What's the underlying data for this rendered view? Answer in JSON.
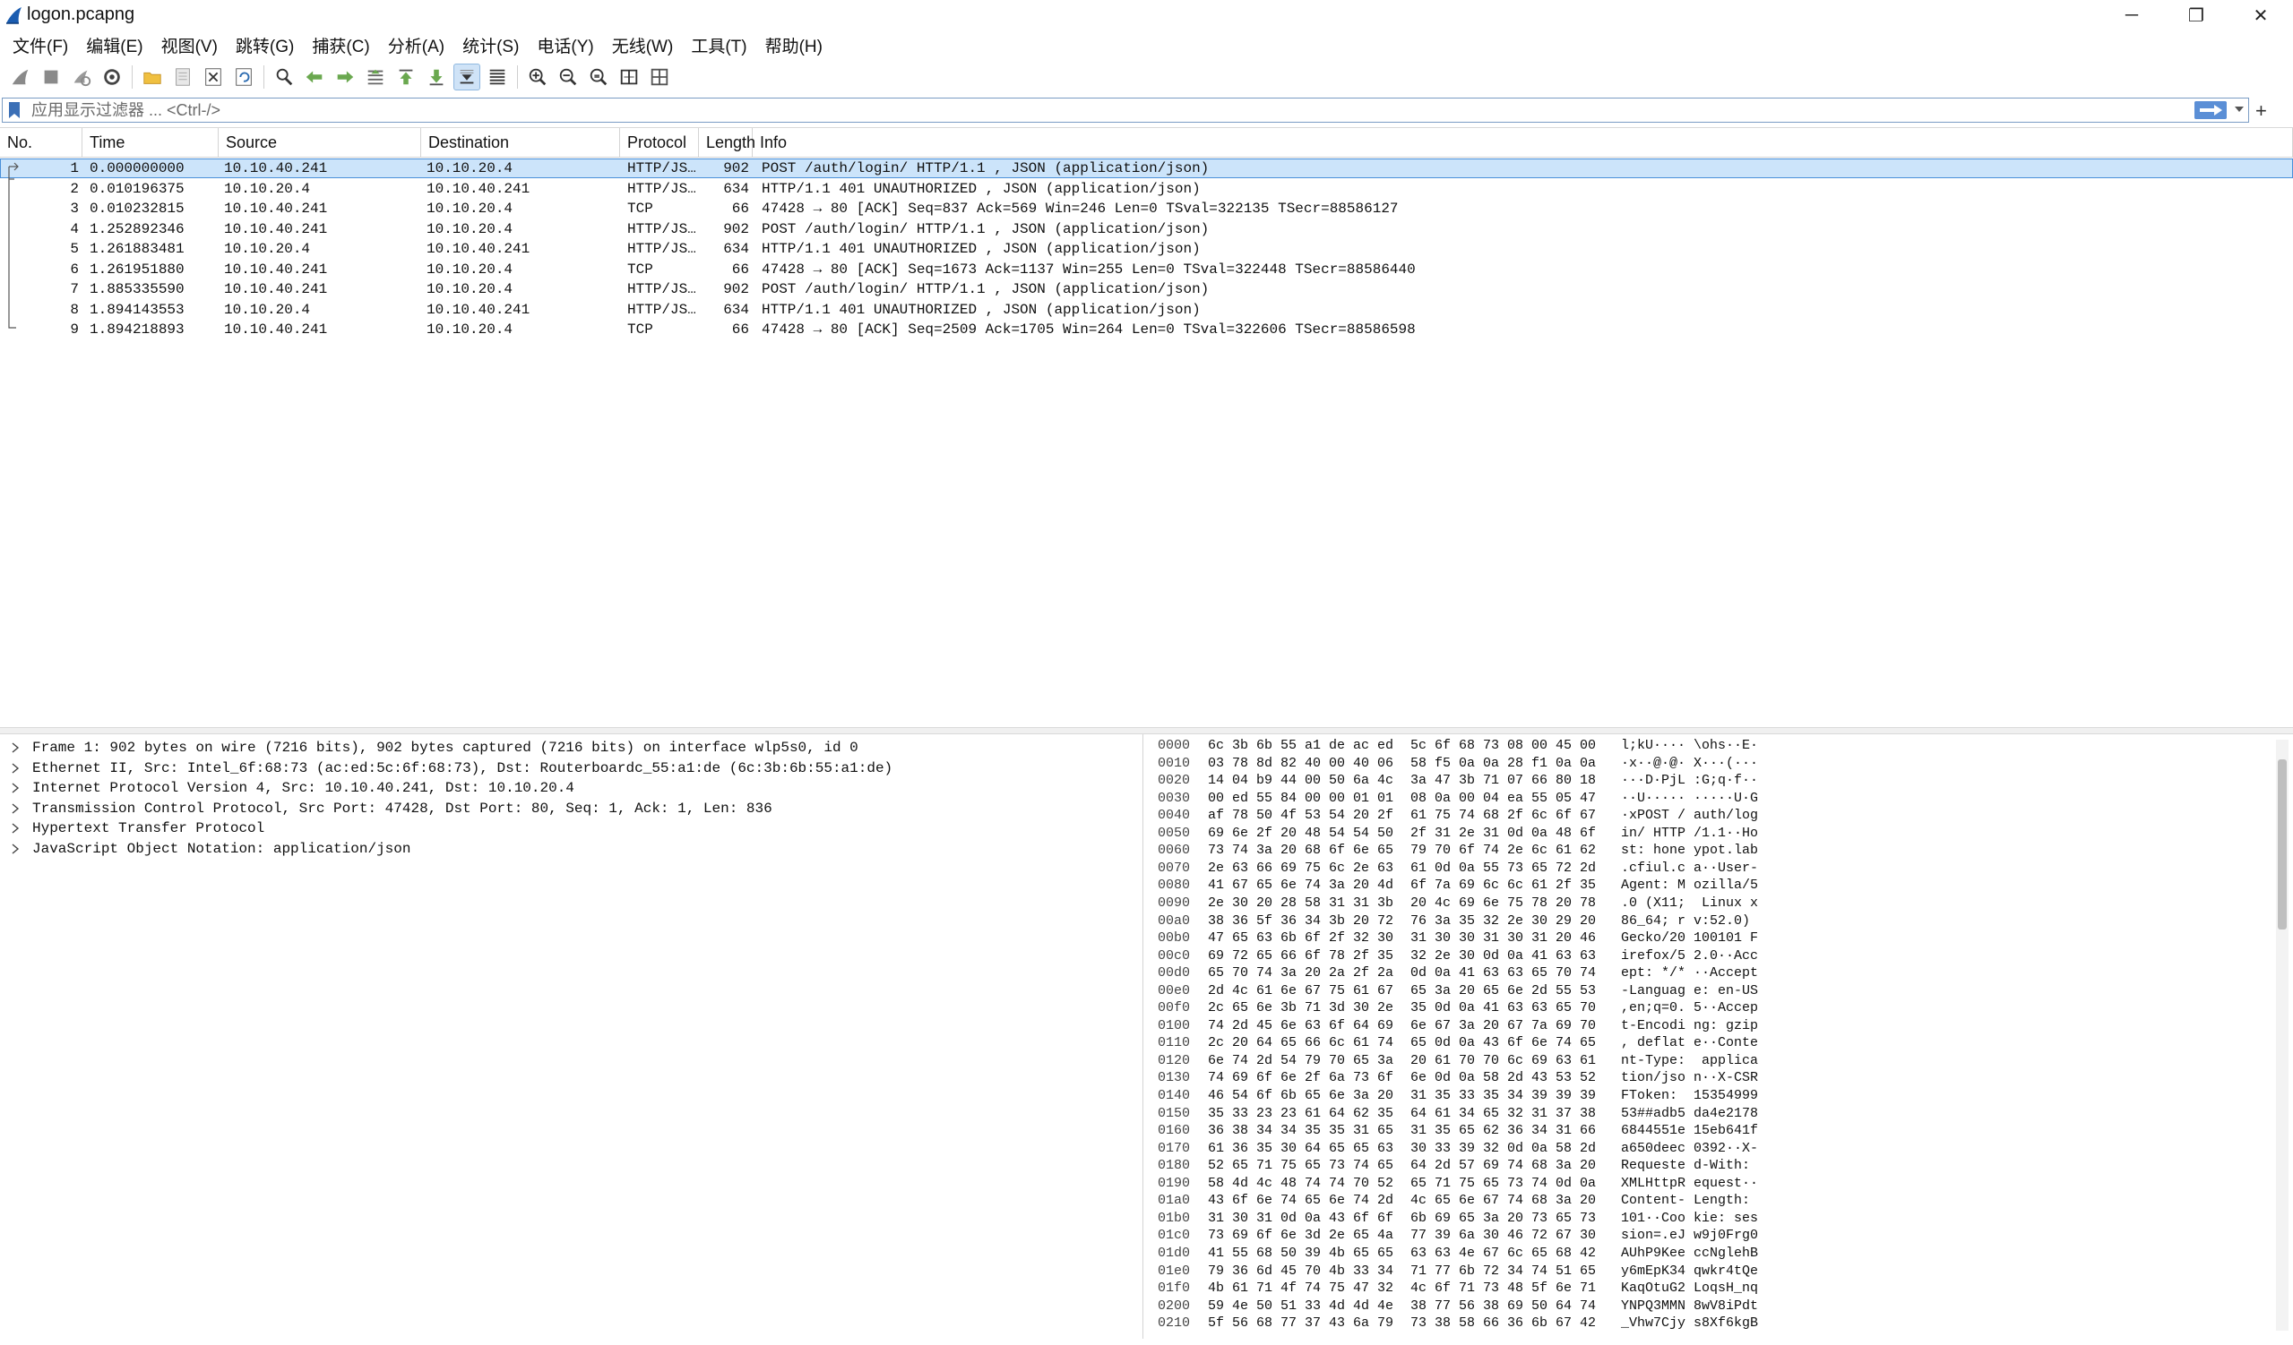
{
  "window": {
    "title": "logon.pcapng",
    "controls": {
      "minimize": "─",
      "maximize": "❐",
      "close": "✕"
    }
  },
  "menu": [
    "文件(F)",
    "编辑(E)",
    "视图(V)",
    "跳转(G)",
    "捕获(C)",
    "分析(A)",
    "统计(S)",
    "电话(Y)",
    "无线(W)",
    "工具(T)",
    "帮助(H)"
  ],
  "toolbar": {
    "icons": [
      "shark-fin-start-icon",
      "stop-capture-icon",
      "restart-capture-icon",
      "capture-options-icon",
      "open-folder-icon",
      "save-file-icon",
      "close-file-icon",
      "reload-file-icon",
      "find-packet-icon",
      "go-back-icon",
      "go-forward-icon",
      "go-to-packet-icon",
      "go-first-icon",
      "go-last-icon",
      "autoscroll-icon",
      "colorize-icon",
      "zoom-in-icon",
      "zoom-out-icon",
      "zoom-normal-icon",
      "resize-columns-icon",
      "layout-icon"
    ],
    "active_icon": "autoscroll-icon"
  },
  "filter": {
    "placeholder": "应用显示过滤器 ... <Ctrl-/>",
    "value": ""
  },
  "packet_list": {
    "columns": [
      "No.",
      "Time",
      "Source",
      "Destination",
      "Protocol",
      "Length",
      "Info"
    ],
    "selected_index": 0,
    "rows": [
      {
        "no": "1",
        "time": "0.000000000",
        "src": "10.10.40.241",
        "dst": "10.10.20.4",
        "proto": "HTTP/JS…",
        "len": "902",
        "info": "POST /auth/login/ HTTP/1.1 , JSON (application/json)"
      },
      {
        "no": "2",
        "time": "0.010196375",
        "src": "10.10.20.4",
        "dst": "10.10.40.241",
        "proto": "HTTP/JS…",
        "len": "634",
        "info": "HTTP/1.1 401 UNAUTHORIZED , JSON (application/json)"
      },
      {
        "no": "3",
        "time": "0.010232815",
        "src": "10.10.40.241",
        "dst": "10.10.20.4",
        "proto": "TCP",
        "len": "66",
        "info": "47428 → 80 [ACK] Seq=837 Ack=569 Win=246 Len=0 TSval=322135 TSecr=88586127"
      },
      {
        "no": "4",
        "time": "1.252892346",
        "src": "10.10.40.241",
        "dst": "10.10.20.4",
        "proto": "HTTP/JS…",
        "len": "902",
        "info": "POST /auth/login/ HTTP/1.1 , JSON (application/json)"
      },
      {
        "no": "5",
        "time": "1.261883481",
        "src": "10.10.20.4",
        "dst": "10.10.40.241",
        "proto": "HTTP/JS…",
        "len": "634",
        "info": "HTTP/1.1 401 UNAUTHORIZED , JSON (application/json)"
      },
      {
        "no": "6",
        "time": "1.261951880",
        "src": "10.10.40.241",
        "dst": "10.10.20.4",
        "proto": "TCP",
        "len": "66",
        "info": "47428 → 80 [ACK] Seq=1673 Ack=1137 Win=255 Len=0 TSval=322448 TSecr=88586440"
      },
      {
        "no": "7",
        "time": "1.885335590",
        "src": "10.10.40.241",
        "dst": "10.10.20.4",
        "proto": "HTTP/JS…",
        "len": "902",
        "info": "POST /auth/login/ HTTP/1.1 , JSON (application/json)"
      },
      {
        "no": "8",
        "time": "1.894143553",
        "src": "10.10.20.4",
        "dst": "10.10.40.241",
        "proto": "HTTP/JS…",
        "len": "634",
        "info": "HTTP/1.1 401 UNAUTHORIZED , JSON (application/json)"
      },
      {
        "no": "9",
        "time": "1.894218893",
        "src": "10.10.40.241",
        "dst": "10.10.20.4",
        "proto": "TCP",
        "len": "66",
        "info": "47428 → 80 [ACK] Seq=2509 Ack=1705 Win=264 Len=0 TSval=322606 TSecr=88586598"
      }
    ]
  },
  "details": [
    "Frame 1: 902 bytes on wire (7216 bits), 902 bytes captured (7216 bits) on interface wlp5s0, id 0",
    "Ethernet II, Src: Intel_6f:68:73 (ac:ed:5c:6f:68:73), Dst: Routerboardc_55:a1:de (6c:3b:6b:55:a1:de)",
    "Internet Protocol Version 4, Src: 10.10.40.241, Dst: 10.10.20.4",
    "Transmission Control Protocol, Src Port: 47428, Dst Port: 80, Seq: 1, Ack: 1, Len: 836",
    "Hypertext Transfer Protocol",
    "JavaScript Object Notation: application/json"
  ],
  "hex": [
    {
      "off": "0000",
      "b1": "6c 3b 6b 55 a1 de ac ed",
      "b2": "5c 6f 68 73 08 00 45 00",
      "a1": "l;kU····",
      "a2": "\\ohs··E·"
    },
    {
      "off": "0010",
      "b1": "03 78 8d 82 40 00 40 06",
      "b2": "58 f5 0a 0a 28 f1 0a 0a",
      "a1": "·x··@·@·",
      "a2": "X···(···"
    },
    {
      "off": "0020",
      "b1": "14 04 b9 44 00 50 6a 4c",
      "b2": "3a 47 3b 71 07 66 80 18",
      "a1": "···D·PjL",
      "a2": ":G;q·f··"
    },
    {
      "off": "0030",
      "b1": "00 ed 55 84 00 00 01 01",
      "b2": "08 0a 00 04 ea 55 05 47",
      "a1": "··U·····",
      "a2": "·····U·G"
    },
    {
      "off": "0040",
      "b1": "af 78 50 4f 53 54 20 2f",
      "b2": "61 75 74 68 2f 6c 6f 67",
      "a1": "·xPOST /",
      "a2": "auth/log"
    },
    {
      "off": "0050",
      "b1": "69 6e 2f 20 48 54 54 50",
      "b2": "2f 31 2e 31 0d 0a 48 6f",
      "a1": "in/ HTTP",
      "a2": "/1.1··Ho"
    },
    {
      "off": "0060",
      "b1": "73 74 3a 20 68 6f 6e 65",
      "b2": "79 70 6f 74 2e 6c 61 62",
      "a1": "st: hone",
      "a2": "ypot.lab"
    },
    {
      "off": "0070",
      "b1": "2e 63 66 69 75 6c 2e 63",
      "b2": "61 0d 0a 55 73 65 72 2d",
      "a1": ".cfiul.c",
      "a2": "a··User-"
    },
    {
      "off": "0080",
      "b1": "41 67 65 6e 74 3a 20 4d",
      "b2": "6f 7a 69 6c 6c 61 2f 35",
      "a1": "Agent: M",
      "a2": "ozilla/5"
    },
    {
      "off": "0090",
      "b1": "2e 30 20 28 58 31 31 3b",
      "b2": "20 4c 69 6e 75 78 20 78",
      "a1": ".0 (X11;",
      "a2": " Linux x"
    },
    {
      "off": "00a0",
      "b1": "38 36 5f 36 34 3b 20 72",
      "b2": "76 3a 35 32 2e 30 29 20",
      "a1": "86_64; r",
      "a2": "v:52.0) "
    },
    {
      "off": "00b0",
      "b1": "47 65 63 6b 6f 2f 32 30",
      "b2": "31 30 30 31 30 31 20 46",
      "a1": "Gecko/20",
      "a2": "100101 F"
    },
    {
      "off": "00c0",
      "b1": "69 72 65 66 6f 78 2f 35",
      "b2": "32 2e 30 0d 0a 41 63 63",
      "a1": "irefox/5",
      "a2": "2.0··Acc"
    },
    {
      "off": "00d0",
      "b1": "65 70 74 3a 20 2a 2f 2a",
      "b2": "0d 0a 41 63 63 65 70 74",
      "a1": "ept: */*",
      "a2": "··Accept"
    },
    {
      "off": "00e0",
      "b1": "2d 4c 61 6e 67 75 61 67",
      "b2": "65 3a 20 65 6e 2d 55 53",
      "a1": "-Languag",
      "a2": "e: en-US"
    },
    {
      "off": "00f0",
      "b1": "2c 65 6e 3b 71 3d 30 2e",
      "b2": "35 0d 0a 41 63 63 65 70",
      "a1": ",en;q=0.",
      "a2": "5··Accep"
    },
    {
      "off": "0100",
      "b1": "74 2d 45 6e 63 6f 64 69",
      "b2": "6e 67 3a 20 67 7a 69 70",
      "a1": "t-Encodi",
      "a2": "ng: gzip"
    },
    {
      "off": "0110",
      "b1": "2c 20 64 65 66 6c 61 74",
      "b2": "65 0d 0a 43 6f 6e 74 65",
      "a1": ", deflat",
      "a2": "e··Conte"
    },
    {
      "off": "0120",
      "b1": "6e 74 2d 54 79 70 65 3a",
      "b2": "20 61 70 70 6c 69 63 61",
      "a1": "nt-Type:",
      "a2": " applica"
    },
    {
      "off": "0130",
      "b1": "74 69 6f 6e 2f 6a 73 6f",
      "b2": "6e 0d 0a 58 2d 43 53 52",
      "a1": "tion/jso",
      "a2": "n··X-CSR"
    },
    {
      "off": "0140",
      "b1": "46 54 6f 6b 65 6e 3a 20",
      "b2": "31 35 33 35 34 39 39 39",
      "a1": "FToken: ",
      "a2": "15354999"
    },
    {
      "off": "0150",
      "b1": "35 33 23 23 61 64 62 35",
      "b2": "64 61 34 65 32 31 37 38",
      "a1": "53##adb5",
      "a2": "da4e2178"
    },
    {
      "off": "0160",
      "b1": "36 38 34 34 35 35 31 65",
      "b2": "31 35 65 62 36 34 31 66",
      "a1": "6844551e",
      "a2": "15eb641f"
    },
    {
      "off": "0170",
      "b1": "61 36 35 30 64 65 65 63",
      "b2": "30 33 39 32 0d 0a 58 2d",
      "a1": "a650deec",
      "a2": "0392··X-"
    },
    {
      "off": "0180",
      "b1": "52 65 71 75 65 73 74 65",
      "b2": "64 2d 57 69 74 68 3a 20",
      "a1": "Requeste",
      "a2": "d-With: "
    },
    {
      "off": "0190",
      "b1": "58 4d 4c 48 74 74 70 52",
      "b2": "65 71 75 65 73 74 0d 0a",
      "a1": "XMLHttpR",
      "a2": "equest··"
    },
    {
      "off": "01a0",
      "b1": "43 6f 6e 74 65 6e 74 2d",
      "b2": "4c 65 6e 67 74 68 3a 20",
      "a1": "Content-",
      "a2": "Length: "
    },
    {
      "off": "01b0",
      "b1": "31 30 31 0d 0a 43 6f 6f",
      "b2": "6b 69 65 3a 20 73 65 73",
      "a1": "101··Coo",
      "a2": "kie: ses"
    },
    {
      "off": "01c0",
      "b1": "73 69 6f 6e 3d 2e 65 4a",
      "b2": "77 39 6a 30 46 72 67 30",
      "a1": "sion=.eJ",
      "a2": "w9j0Frg0"
    },
    {
      "off": "01d0",
      "b1": "41 55 68 50 39 4b 65 65",
      "b2": "63 63 4e 67 6c 65 68 42",
      "a1": "AUhP9Kee",
      "a2": "ccNglehB"
    },
    {
      "off": "01e0",
      "b1": "79 36 6d 45 70 4b 33 34",
      "b2": "71 77 6b 72 34 74 51 65",
      "a1": "y6mEpK34",
      "a2": "qwkr4tQe"
    },
    {
      "off": "01f0",
      "b1": "4b 61 71 4f 74 75 47 32",
      "b2": "4c 6f 71 73 48 5f 6e 71",
      "a1": "KaqOtuG2",
      "a2": "LoqsH_nq"
    },
    {
      "off": "0200",
      "b1": "59 4e 50 51 33 4d 4d 4e",
      "b2": "38 77 56 38 69 50 64 74",
      "a1": "YNPQ3MMN",
      "a2": "8wV8iPdt"
    },
    {
      "off": "0210",
      "b1": "5f 56 68 77 37 43 6a 79",
      "b2": "73 38 58 66 36 6b 67 42",
      "a1": "_Vhw7Cjy",
      "a2": "s8Xf6kgB"
    }
  ],
  "colors": {
    "accent": "#4a90d9",
    "selected_row": "#cce4fa",
    "filter_border": "#7a9cc4",
    "apply_arrow": "#5b8fd6"
  }
}
